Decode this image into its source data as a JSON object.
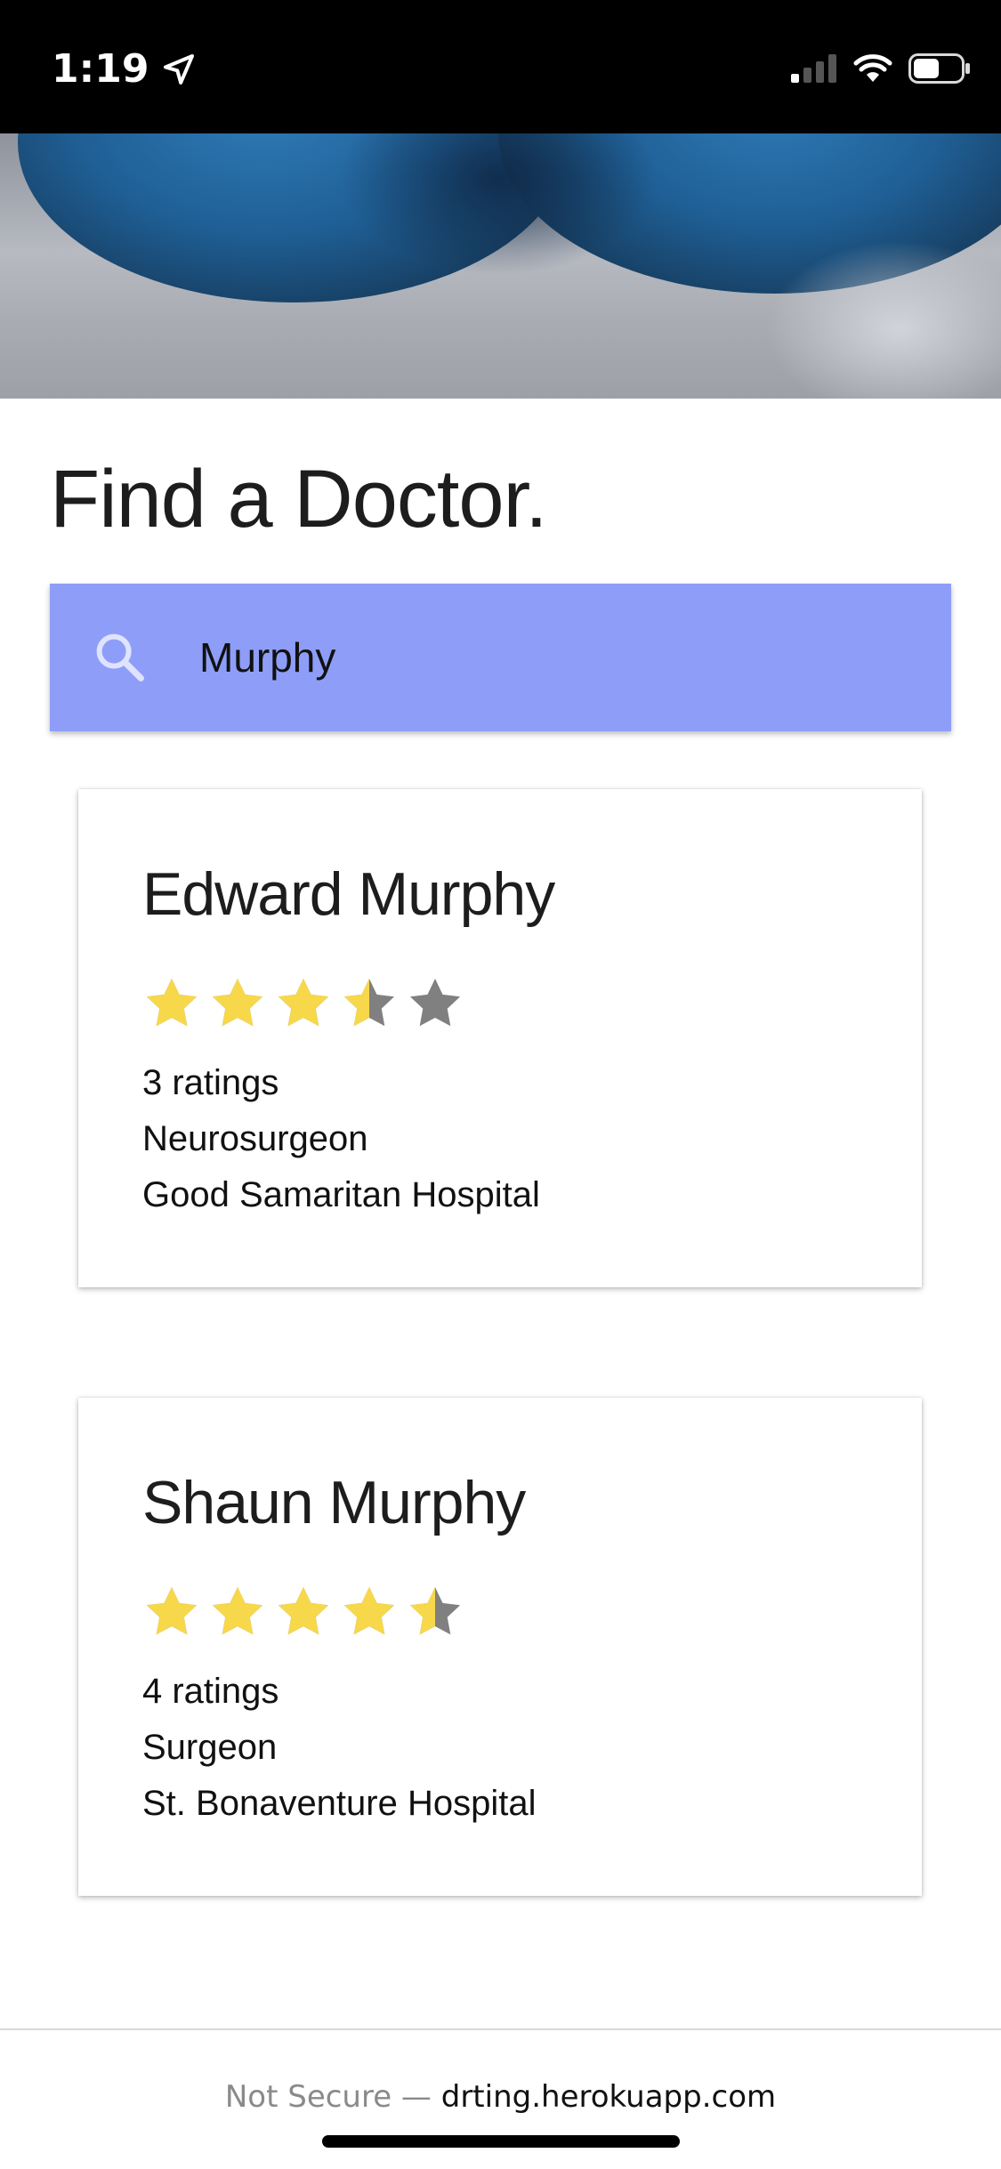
{
  "status_bar": {
    "time": "1:19",
    "location_icon": "location-arrow-icon",
    "signal_icon": "cellular-signal-icon",
    "wifi_icon": "wifi-icon",
    "battery_icon": "battery-icon",
    "signal_bars_active": 1,
    "signal_bars_total": 4,
    "battery_level": 0.55
  },
  "hero": {
    "image_icon": "hero-photo"
  },
  "page": {
    "title": "Find a Doctor."
  },
  "search": {
    "icon": "search-icon",
    "value": "Murphy",
    "background_color": "#8e9ef8"
  },
  "doctors": [
    {
      "name": "Edward Murphy",
      "rating": 3.5,
      "max_rating": 5,
      "ratings_count": "3 ratings",
      "specialty": "Neurosurgeon",
      "hospital": "Good Samaritan Hospital"
    },
    {
      "name": "Shaun Murphy",
      "rating": 4.5,
      "max_rating": 5,
      "ratings_count": "4 ratings",
      "specialty": "Surgeon",
      "hospital": "St. Bonaventure Hospital"
    }
  ],
  "colors": {
    "star_filled": "#f7d84b",
    "star_empty": "#808080",
    "title_text": "#1d1d1d"
  },
  "browser": {
    "security_label": "Not Secure —",
    "domain": "drting.herokuapp.com"
  }
}
